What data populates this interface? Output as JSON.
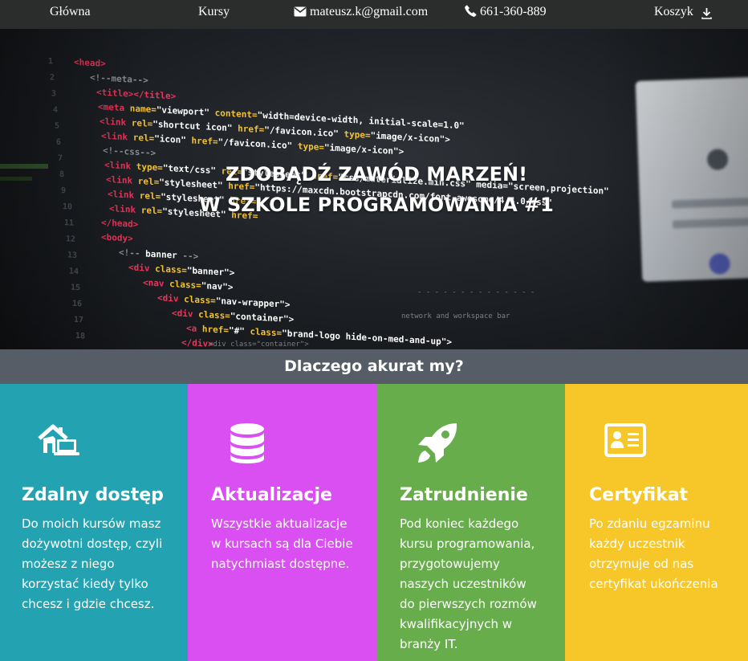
{
  "nav": {
    "home": "Główna",
    "courses": "Kursy",
    "email": "mateusz.k@gmail.com",
    "phone": "661-360-889",
    "cart": "Koszyk"
  },
  "hero": {
    "line1": "ZDOBĄDŹ ZAWÓD MARZEŃ!",
    "line2": "W SZKOLE PROGRAMOWANIA #1"
  },
  "why": {
    "heading": "Dlaczego akurat my?"
  },
  "features": [
    {
      "icon": "home-laptop-icon",
      "title": "Zdalny dostęp",
      "text": "Do moich kursów masz\ndożywotni dostęp, czyli\nmożesz z niego\nkorzystać kiedy tylko\nchcesz i gdzie chcesz.",
      "color": "#23a3b1"
    },
    {
      "icon": "database-icon",
      "title": "Aktualizacje",
      "text": "Wszystkie aktualizacje\nw kursach są dla Ciebie\nnatychmiast dostępne.",
      "color": "#d94ff2"
    },
    {
      "icon": "rocket-icon",
      "title": "Zatrudnienie",
      "text": "Pod koniec każdego\nkursu programowania,\nprzygotowujemy\nnaszych uczestników\ndo pierwszych rozmów\nkwalifikacyjnych w\nbranży IT.",
      "color": "#68ad4c"
    },
    {
      "icon": "id-card-icon",
      "title": "Certyfikat",
      "text": "Po zdaniu egzaminu\nkażdy uczestnik\notrzymuje od nas\ncertyfikat ukończenia",
      "color": "#f7c72a"
    }
  ]
}
